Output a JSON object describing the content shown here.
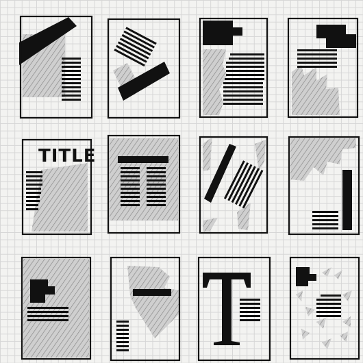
{
  "sketch_title_text": "TITLE",
  "colors": {
    "ink": "#111111",
    "paper": "#f3f3f1",
    "grid": "#d6d6d6",
    "hatch": "#888888"
  }
}
